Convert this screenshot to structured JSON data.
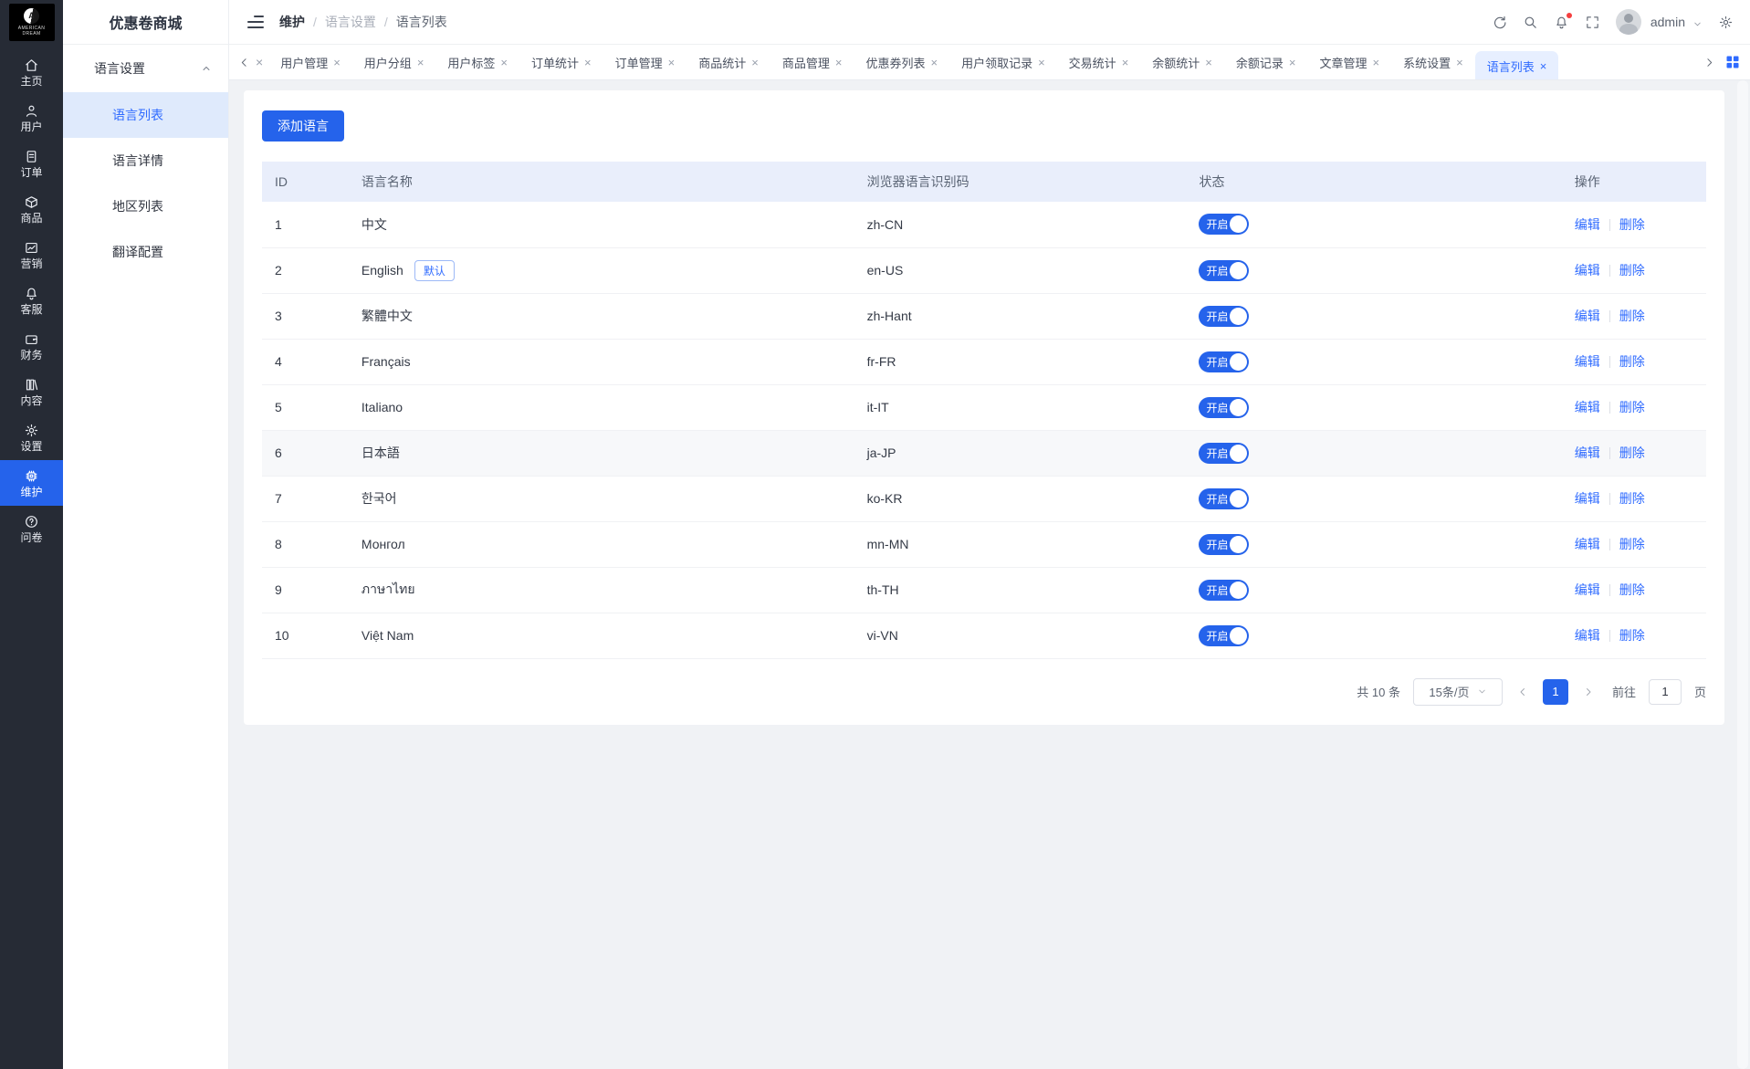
{
  "app": {
    "title": "优惠卷商城",
    "logo": {
      "letter": "A",
      "line1": "AMERICAN",
      "line2": "DREAM"
    }
  },
  "colors": {
    "accent": "#2563eb",
    "link_blue": "#2f6bff",
    "active_tab_bg": "#e7efff",
    "submenu_active_bg": "#dfeafc",
    "table_header_bg": "#e9eefb",
    "rail_bg": "#262b35",
    "notification_dot": "#f53f3f"
  },
  "rail": {
    "items": [
      {
        "label": "主页",
        "icon": "home-icon",
        "active": false
      },
      {
        "label": "用户",
        "icon": "user-icon",
        "active": false
      },
      {
        "label": "订单",
        "icon": "order-icon",
        "active": false
      },
      {
        "label": "商品",
        "icon": "goods-icon",
        "active": false
      },
      {
        "label": "营销",
        "icon": "marketing-icon",
        "active": false
      },
      {
        "label": "客服",
        "icon": "support-bell-icon",
        "active": false
      },
      {
        "label": "财务",
        "icon": "finance-wallet-icon",
        "active": false
      },
      {
        "label": "内容",
        "icon": "content-icon",
        "active": false
      },
      {
        "label": "设置",
        "icon": "settings-gear-icon",
        "active": false
      },
      {
        "label": "维护",
        "icon": "maintenance-chip-icon",
        "active": true
      },
      {
        "label": "问卷",
        "icon": "survey-question-icon",
        "active": false
      }
    ]
  },
  "submenu": {
    "group": "语言设置",
    "items": [
      {
        "label": "语言列表",
        "active": true
      },
      {
        "label": "语言详情",
        "active": false
      },
      {
        "label": "地区列表",
        "active": false
      },
      {
        "label": "翻译配置",
        "active": false
      }
    ]
  },
  "topbar": {
    "breadcrumb": [
      "维护",
      "语言设置",
      "语言列表"
    ],
    "separator": "/",
    "username": "admin"
  },
  "tabs": {
    "items": [
      {
        "label": "用户管理",
        "active": false
      },
      {
        "label": "用户分组",
        "active": false
      },
      {
        "label": "用户标签",
        "active": false
      },
      {
        "label": "订单统计",
        "active": false
      },
      {
        "label": "订单管理",
        "active": false
      },
      {
        "label": "商品统计",
        "active": false
      },
      {
        "label": "商品管理",
        "active": false
      },
      {
        "label": "优惠券列表",
        "active": false
      },
      {
        "label": "用户领取记录",
        "active": false
      },
      {
        "label": "交易统计",
        "active": false
      },
      {
        "label": "余额统计",
        "active": false
      },
      {
        "label": "余额记录",
        "active": false
      },
      {
        "label": "文章管理",
        "active": false
      },
      {
        "label": "系统设置",
        "active": false
      },
      {
        "label": "语言列表",
        "active": true
      }
    ],
    "close_glyph": "×"
  },
  "main": {
    "add_button_label": "添加语言",
    "table": {
      "columns": [
        "ID",
        "语言名称",
        "浏览器语言识别码",
        "状态",
        "操作"
      ],
      "action_edit": "编辑",
      "action_delete": "删除",
      "rows": [
        {
          "id": "1",
          "name": "中文",
          "badge": "",
          "code": "zh-CN",
          "status": "开启",
          "hovered": false
        },
        {
          "id": "2",
          "name": "English",
          "badge": "默认",
          "code": "en-US",
          "status": "开启",
          "hovered": false
        },
        {
          "id": "3",
          "name": "繁體中文",
          "badge": "",
          "code": "zh-Hant",
          "status": "开启",
          "hovered": false
        },
        {
          "id": "4",
          "name": "Français",
          "badge": "",
          "code": "fr-FR",
          "status": "开启",
          "hovered": false
        },
        {
          "id": "5",
          "name": "Italiano",
          "badge": "",
          "code": "it-IT",
          "status": "开启",
          "hovered": false
        },
        {
          "id": "6",
          "name": "日本語",
          "badge": "",
          "code": "ja-JP",
          "status": "开启",
          "hovered": true
        },
        {
          "id": "7",
          "name": "한국어",
          "badge": "",
          "code": "ko-KR",
          "status": "开启",
          "hovered": false
        },
        {
          "id": "8",
          "name": "Монгол",
          "badge": "",
          "code": "mn-MN",
          "status": "开启",
          "hovered": false
        },
        {
          "id": "9",
          "name": "ภาษาไทย",
          "badge": "",
          "code": "th-TH",
          "status": "开启",
          "hovered": false
        },
        {
          "id": "10",
          "name": "Việt Nam",
          "badge": "",
          "code": "vi-VN",
          "status": "开启",
          "hovered": false
        }
      ]
    },
    "pagination": {
      "total": "共 10 条",
      "page_size": "15条/页",
      "current_page": "1",
      "goto_label": "前往",
      "goto_value": "1",
      "page_unit": "页"
    }
  }
}
